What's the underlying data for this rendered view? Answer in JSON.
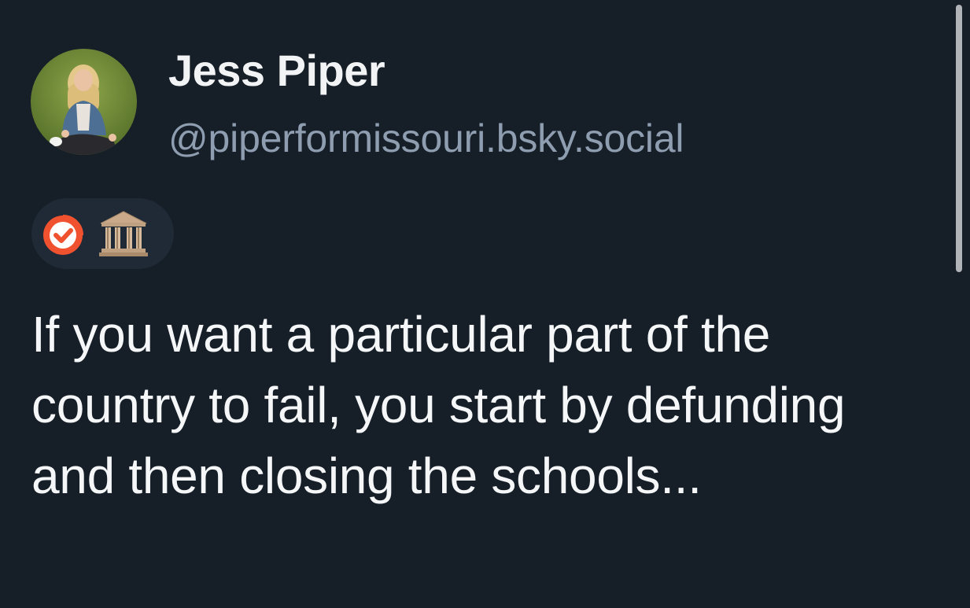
{
  "post": {
    "author": {
      "display_name": "Jess Piper",
      "handle": "@piperformissouri.bsky.social",
      "avatar_icon": "profile-photo"
    },
    "badges": [
      {
        "icon": "verified-check-icon",
        "color": "#f0512e"
      },
      {
        "icon": "classical-building-icon",
        "glyph": "🏛"
      }
    ],
    "text": "If you want a particular part of the country to fail, you start by defunding and then closing the schools..."
  },
  "colors": {
    "background": "#161e27",
    "badge_pill": "#1f2a36",
    "handle_text": "#8f9db0",
    "body_text": "#f4f6f8",
    "verified": "#f0512e"
  }
}
